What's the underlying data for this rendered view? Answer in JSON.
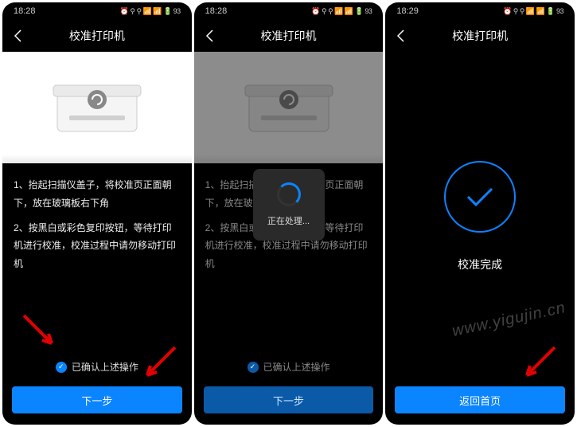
{
  "screens": [
    {
      "time": "18:28",
      "status_icons": "⏰ ⚲ ⚲ 📶 📶 🔋 93",
      "title": "校准打印机",
      "instruction1": "1、抬起扫描仪盖子，将校准页正面朝下，放在玻璃板右下角",
      "instruction2": "2、按黑白或彩色复印按钮，等待打印机进行校准，校准过程中请勿移动打印机",
      "confirm_label": "已确认上述操作",
      "button_label": "下一步"
    },
    {
      "time": "18:28",
      "status_icons": "⏰ ⚲ ⚲ 📶 📶 🔋 93",
      "title": "校准打印机",
      "instruction1": "1、抬起扫描仪盖子，将校准页正面朝下，放在玻璃板右下角",
      "instruction2": "2、按黑白或彩色复印按钮，等待打印机进行校准，校准过程中请勿移动打印机",
      "confirm_label": "已确认上述操作",
      "button_label": "下一步",
      "modal_text": "正在处理..."
    },
    {
      "time": "18:29",
      "status_icons": "⏰ ⚲ ⚲ 📶 📶 🔋 93",
      "title": "校准打印机",
      "success_text": "校准完成",
      "button_label": "返回首页"
    }
  ],
  "watermark": "www.yigujin.cn"
}
